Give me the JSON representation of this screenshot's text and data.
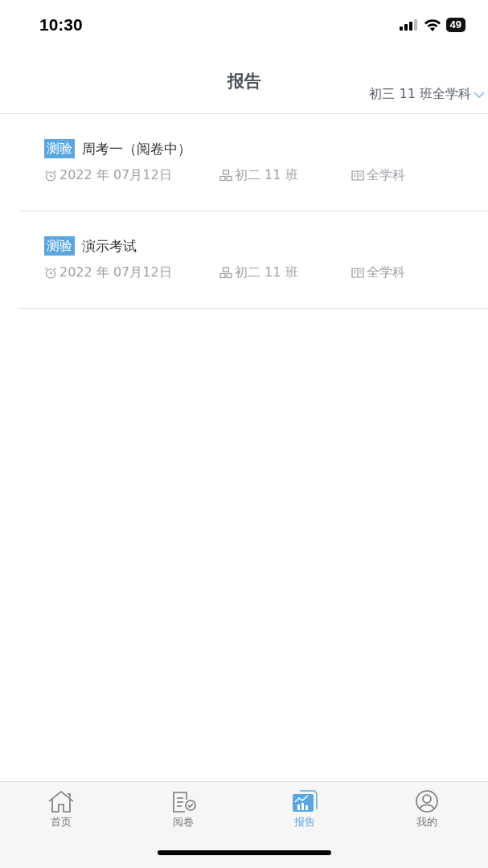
{
  "status_bar": {
    "time": "10:30",
    "battery": "49"
  },
  "header": {
    "title": "报告",
    "filter": "初三 11 班全学科"
  },
  "reports": [
    {
      "tag": "测验",
      "title": "周考一（阅卷中）",
      "date": "2022 年 07月12日",
      "class": "初二 11 班",
      "subject": "全学科"
    },
    {
      "tag": "测验",
      "title": "演示考试",
      "date": "2022 年 07月12日",
      "class": "初二 11 班",
      "subject": "全学科"
    }
  ],
  "tab_bar": [
    {
      "kind": "home",
      "label": "首页",
      "selected": false
    },
    {
      "kind": "review",
      "label": "阅卷",
      "selected": false
    },
    {
      "kind": "report",
      "label": "报告",
      "selected": true
    },
    {
      "kind": "profile",
      "label": "我的",
      "selected": false
    }
  ]
}
